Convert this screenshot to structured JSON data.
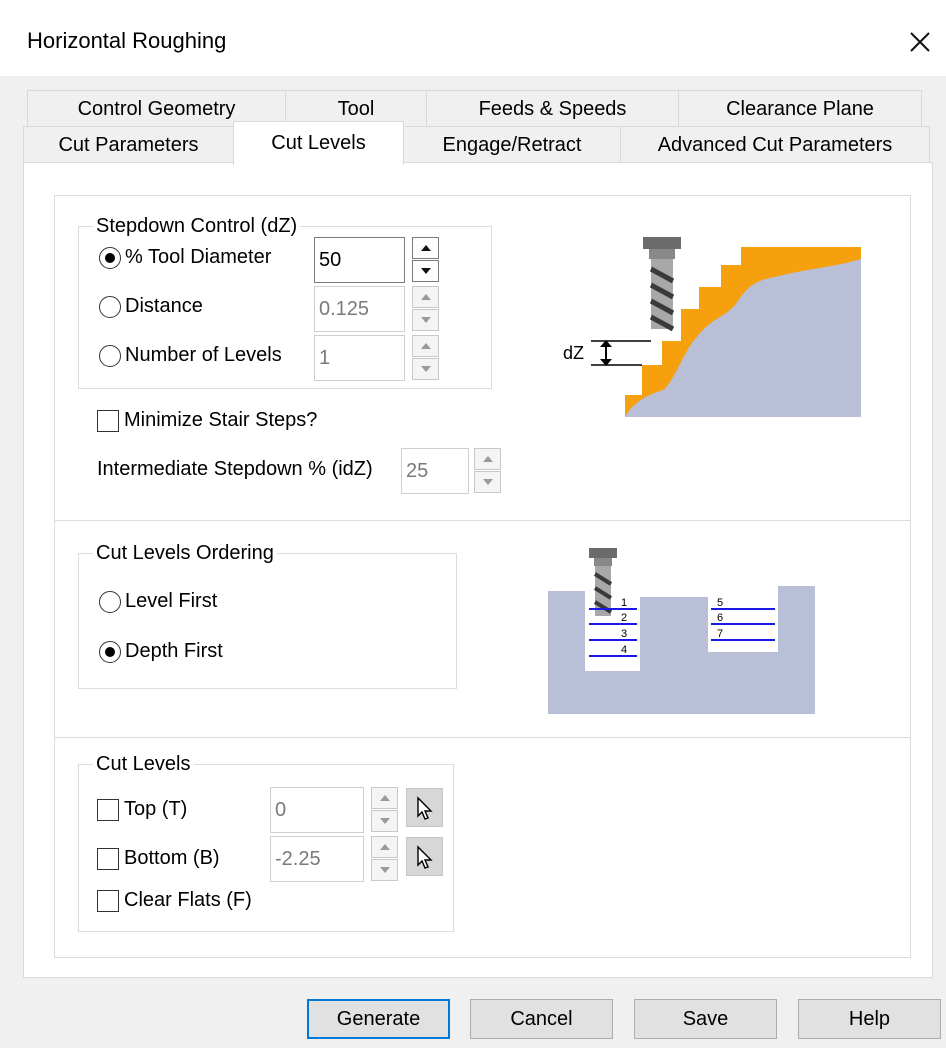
{
  "window": {
    "title": "Horizontal Roughing",
    "close_icon": "close-icon"
  },
  "tabs": {
    "row1": [
      "Control Geometry",
      "Tool",
      "Feeds & Speeds",
      "Clearance Plane"
    ],
    "row2": [
      "Cut Parameters",
      "Cut Levels",
      "Engage/Retract",
      "Advanced Cut Parameters"
    ],
    "active": "Cut Levels"
  },
  "stepdown": {
    "legend": "Stepdown Control (dZ)",
    "options": [
      {
        "label": "% Tool Diameter",
        "selected": true,
        "value": "50",
        "enabled": true
      },
      {
        "label": "Distance",
        "selected": false,
        "value": "0.125",
        "enabled": false
      },
      {
        "label": "Number of Levels",
        "selected": false,
        "value": "1",
        "enabled": false
      }
    ],
    "minimize_label": "Minimize Stair Steps?",
    "minimize_checked": false,
    "intermediate_label": "Intermediate Stepdown % (idZ)",
    "intermediate_value": "25",
    "diagram_label": "dZ"
  },
  "ordering": {
    "legend": "Cut Levels Ordering",
    "options": [
      {
        "label": "Level First",
        "selected": false
      },
      {
        "label": "Depth First",
        "selected": true
      }
    ],
    "diagram_levels_left": [
      "1",
      "2",
      "3",
      "4"
    ],
    "diagram_levels_right": [
      "5",
      "6",
      "7"
    ]
  },
  "cut_levels": {
    "legend": "Cut Levels",
    "top_label": "Top (T)",
    "top_checked": false,
    "top_value": "0",
    "bottom_label": "Bottom (B)",
    "bottom_checked": false,
    "bottom_value": "-2.25",
    "clear_flats_label": "Clear Flats (F)",
    "clear_flats_checked": false
  },
  "buttons": {
    "generate": "Generate",
    "cancel": "Cancel",
    "save": "Save",
    "help": "Help"
  },
  "colors": {
    "accent": "#0078d7",
    "stock_orange": "#f5a00c",
    "part_gray": "#b9bfd6",
    "level_blue": "#1a1ae6"
  }
}
